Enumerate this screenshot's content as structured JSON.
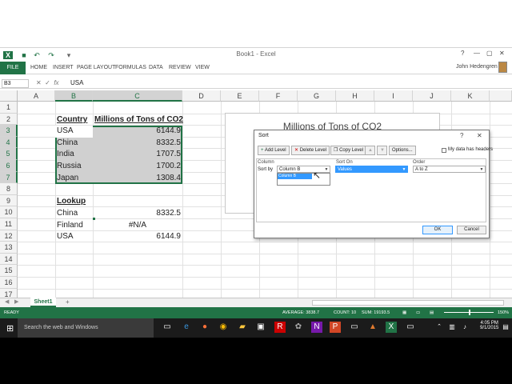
{
  "window": {
    "title": "Book1 - Excel",
    "help": "?",
    "minimize": "—",
    "restore": "▢",
    "close": "✕"
  },
  "ribbon": {
    "file": "FILE",
    "tabs": [
      "HOME",
      "INSERT",
      "PAGE LAYOUT",
      "FORMULAS",
      "DATA",
      "REVIEW",
      "VIEW"
    ],
    "user": "John Hedengren"
  },
  "formula_bar": {
    "name_box": "B3",
    "fx": "fx",
    "value": "USA"
  },
  "columns": [
    "A",
    "B",
    "C",
    "D",
    "E",
    "F",
    "G",
    "H",
    "I",
    "J",
    "K"
  ],
  "rows": [
    "1",
    "2",
    "3",
    "4",
    "5",
    "6",
    "7",
    "8",
    "9",
    "10",
    "11",
    "12",
    "13",
    "14",
    "15",
    "16",
    "17"
  ],
  "sheet": {
    "header_country": "Country",
    "header_co2": "Millions of Tons of CO2",
    "data": [
      {
        "country": "USA",
        "value": "6144.9"
      },
      {
        "country": "China",
        "value": "8332.5"
      },
      {
        "country": "India",
        "value": "1707.5"
      },
      {
        "country": "Russia",
        "value": "1700.2"
      },
      {
        "country": "Japan",
        "value": "1308.4"
      }
    ],
    "lookup_label": "Lookup",
    "lookup": [
      {
        "country": "China",
        "value": "8332.5"
      },
      {
        "country": "Finland",
        "value": "#N/A"
      },
      {
        "country": "USA",
        "value": "6144.9"
      }
    ]
  },
  "chart": {
    "title": "Millions of Tons of CO2"
  },
  "sort_dialog": {
    "title": "Sort",
    "help": "?",
    "close": "✕",
    "add_level": "Add Level",
    "delete_level": "Delete Level",
    "copy_level": "Copy Level",
    "options": "Options...",
    "my_data_has_headers": "My data has headers",
    "col_header": "Column",
    "sort_on_header": "Sort On",
    "order_header": "Order",
    "sort_by": "Sort by",
    "column_value": "Column B",
    "sort_on_value": "Values",
    "order_value": "A to Z",
    "dropdown_item": "Column B",
    "ok": "OK",
    "cancel": "Cancel"
  },
  "sheet_tabs": {
    "active": "Sheet1",
    "add": "+"
  },
  "status": {
    "ready": "READY",
    "average": "AVERAGE: 3838.7",
    "count": "COUNT: 10",
    "sum": "SUM: 19193.5",
    "zoom": "150%"
  },
  "taskbar": {
    "search_placeholder": "Search the web and Windows",
    "time": "4:05 PM",
    "date": "9/1/2015"
  },
  "colors": {
    "excel_green": "#217346",
    "selection_gray": "#d0d0d0",
    "highlight_blue": "#3399ff"
  }
}
